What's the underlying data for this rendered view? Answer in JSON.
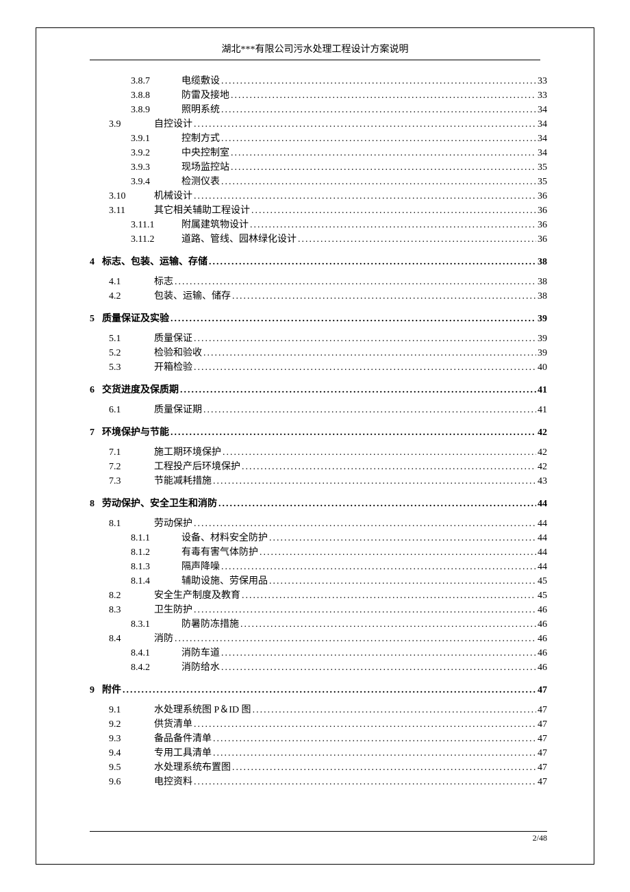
{
  "header": "湖北***有限公司污水处理工程设计方案说明",
  "footer": "2/48",
  "entries": [
    {
      "indent": 2,
      "num": "3.8.7",
      "title": "电缆敷设",
      "page": "33"
    },
    {
      "indent": 2,
      "num": "3.8.8",
      "title": "防雷及接地",
      "page": "33"
    },
    {
      "indent": 2,
      "num": "3.8.9",
      "title": "照明系统",
      "page": "34"
    },
    {
      "indent": 1,
      "num": "3.9",
      "title": "自控设计",
      "page": "34"
    },
    {
      "indent": 2,
      "num": "3.9.1",
      "title": "控制方式",
      "page": "34"
    },
    {
      "indent": 2,
      "num": "3.9.2",
      "title": "中央控制室",
      "page": "34"
    },
    {
      "indent": 2,
      "num": "3.9.3",
      "title": "现场监控站",
      "page": "35"
    },
    {
      "indent": 2,
      "num": "3.9.4",
      "title": "检测仪表",
      "page": "35"
    },
    {
      "indent": 1,
      "num": "3.10",
      "title": "机械设计",
      "page": "36"
    },
    {
      "indent": 1,
      "num": "3.11",
      "title": "其它相关辅助工程设计",
      "page": "36"
    },
    {
      "indent": 2,
      "num": "3.11.1",
      "title": "附属建筑物设计",
      "page": "36"
    },
    {
      "indent": 2,
      "num": "3.11.2",
      "title": "道路、管线、园林绿化设计",
      "page": "36"
    },
    {
      "indent": 0,
      "num": "4",
      "title": "标志、包装、运输、存储",
      "page": "38",
      "section": true
    },
    {
      "indent": 1,
      "num": "4.1",
      "title": "标志",
      "page": "38"
    },
    {
      "indent": 1,
      "num": "4.2",
      "title": "包装、运输、储存",
      "page": "38"
    },
    {
      "indent": 0,
      "num": "5",
      "title": "质量保证及实验",
      "page": "39",
      "section": true
    },
    {
      "indent": 1,
      "num": "5.1",
      "title": "质量保证",
      "page": "39"
    },
    {
      "indent": 1,
      "num": "5.2",
      "title": "检验和验收",
      "page": "39"
    },
    {
      "indent": 1,
      "num": "5.3",
      "title": "开箱检验",
      "page": "40"
    },
    {
      "indent": 0,
      "num": "6",
      "title": "交货进度及保质期",
      "page": "41",
      "section": true
    },
    {
      "indent": 1,
      "num": "6.1",
      "title": "质量保证期",
      "page": "41"
    },
    {
      "indent": 0,
      "num": "7",
      "title": "环境保护与节能",
      "page": "42",
      "section": true
    },
    {
      "indent": 1,
      "num": "7.1",
      "title": "施工期环境保护",
      "page": "42"
    },
    {
      "indent": 1,
      "num": "7.2",
      "title": "工程投产后环境保护",
      "page": "42"
    },
    {
      "indent": 1,
      "num": "7.3",
      "title": "节能减耗措施",
      "page": "43"
    },
    {
      "indent": 0,
      "num": "8",
      "title": "劳动保护、安全卫生和消防",
      "page": "44",
      "section": true
    },
    {
      "indent": 1,
      "num": "8.1",
      "title": "劳动保护",
      "page": "44"
    },
    {
      "indent": 2,
      "num": "8.1.1",
      "title": "设备、材料安全防护",
      "page": "44"
    },
    {
      "indent": 2,
      "num": "8.1.2",
      "title": "有毒有害气体防护",
      "page": "44"
    },
    {
      "indent": 2,
      "num": "8.1.3",
      "title": "隔声降噪",
      "page": "44"
    },
    {
      "indent": 2,
      "num": "8.1.4",
      "title": "辅助设施、劳保用品",
      "page": "45"
    },
    {
      "indent": 1,
      "num": "8.2",
      "title": "安全生产制度及教育",
      "page": "45"
    },
    {
      "indent": 1,
      "num": "8.3",
      "title": "卫生防护",
      "page": "46"
    },
    {
      "indent": 2,
      "num": "8.3.1",
      "title": "防暑防冻措施",
      "page": "46"
    },
    {
      "indent": 1,
      "num": "8.4",
      "title": "消防",
      "page": "46"
    },
    {
      "indent": 2,
      "num": "8.4.1",
      "title": "消防车道",
      "page": "46"
    },
    {
      "indent": 2,
      "num": "8.4.2",
      "title": "消防给水",
      "page": "46"
    },
    {
      "indent": 0,
      "num": "9",
      "title": "附件",
      "page": "47",
      "section": true
    },
    {
      "indent": 1,
      "num": "9.1",
      "title": "水处理系统图 P＆ID 图",
      "page": "47"
    },
    {
      "indent": 1,
      "num": "9.2",
      "title": "供货清单",
      "page": "47"
    },
    {
      "indent": 1,
      "num": "9.3",
      "title": "备品备件清单",
      "page": "47"
    },
    {
      "indent": 1,
      "num": "9.4",
      "title": "专用工具清单",
      "page": "47"
    },
    {
      "indent": 1,
      "num": "9.5",
      "title": "水处理系统布置图",
      "page": "47"
    },
    {
      "indent": 1,
      "num": "9.6",
      "title": "电控资料",
      "page": "47"
    }
  ]
}
